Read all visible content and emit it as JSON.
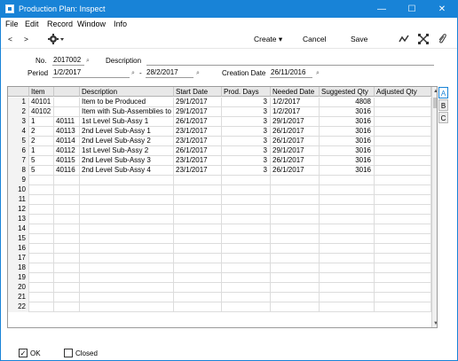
{
  "window": {
    "title": "Production Plan: Inspect",
    "minimize": "—",
    "maximize": "☐",
    "close": "✕"
  },
  "menu": [
    "File",
    "Edit",
    "Record",
    "Window",
    "Info"
  ],
  "toolbar": {
    "back": "<",
    "forward": ">",
    "create": "Create",
    "cancel": "Cancel",
    "save": "Save",
    "icons": [
      "gear-icon",
      "chart-icon",
      "expand-icon",
      "paperclip-icon"
    ]
  },
  "form": {
    "no_label": "No.",
    "no_value": "2017002",
    "description_label": "Description",
    "description_value": "",
    "period_label": "Period",
    "period_from": "1/2/2017",
    "period_sep": "-",
    "period_to": "28/2/2017",
    "creation_label": "Creation Date",
    "creation_value": "26/11/2016"
  },
  "grid": {
    "columns": [
      "",
      "Item",
      "",
      "Description",
      "Start Date",
      "Prod. Days",
      "Needed Date",
      "Suggested Qty",
      "Adjusted Qty"
    ],
    "rows": [
      [
        "1",
        "40101",
        "",
        "Item to be Produced",
        "29/1/2017",
        "3",
        "1/2/2017",
        "4808",
        ""
      ],
      [
        "2",
        "40102",
        "",
        "Item with Sub-Assemblies to b",
        "29/1/2017",
        "3",
        "1/2/2017",
        "3016",
        ""
      ],
      [
        "3",
        "1",
        "40111",
        "1st Level Sub-Assy 1",
        "26/1/2017",
        "3",
        "29/1/2017",
        "3016",
        ""
      ],
      [
        "4",
        "2",
        "40113",
        "2nd Level Sub-Assy 1",
        "23/1/2017",
        "3",
        "26/1/2017",
        "3016",
        ""
      ],
      [
        "5",
        "2",
        "40114",
        "2nd Level Sub-Assy 2",
        "23/1/2017",
        "3",
        "26/1/2017",
        "3016",
        ""
      ],
      [
        "6",
        "1",
        "40112",
        "1st Level Sub-Assy 2",
        "26/1/2017",
        "3",
        "29/1/2017",
        "3016",
        ""
      ],
      [
        "7",
        "5",
        "40115",
        "2nd Level Sub-Assy 3",
        "23/1/2017",
        "3",
        "26/1/2017",
        "3016",
        ""
      ],
      [
        "8",
        "5",
        "40116",
        "2nd Level Sub-Assy 4",
        "23/1/2017",
        "3",
        "26/1/2017",
        "3016",
        ""
      ],
      [
        "9",
        "",
        "",
        "",
        "",
        "",
        "",
        "",
        ""
      ],
      [
        "10",
        "",
        "",
        "",
        "",
        "",
        "",
        "",
        ""
      ],
      [
        "11",
        "",
        "",
        "",
        "",
        "",
        "",
        "",
        ""
      ],
      [
        "12",
        "",
        "",
        "",
        "",
        "",
        "",
        "",
        ""
      ],
      [
        "13",
        "",
        "",
        "",
        "",
        "",
        "",
        "",
        ""
      ],
      [
        "14",
        "",
        "",
        "",
        "",
        "",
        "",
        "",
        ""
      ],
      [
        "15",
        "",
        "",
        "",
        "",
        "",
        "",
        "",
        ""
      ],
      [
        "16",
        "",
        "",
        "",
        "",
        "",
        "",
        "",
        ""
      ],
      [
        "17",
        "",
        "",
        "",
        "",
        "",
        "",
        "",
        ""
      ],
      [
        "18",
        "",
        "",
        "",
        "",
        "",
        "",
        "",
        ""
      ],
      [
        "19",
        "",
        "",
        "",
        "",
        "",
        "",
        "",
        ""
      ],
      [
        "20",
        "",
        "",
        "",
        "",
        "",
        "",
        "",
        ""
      ],
      [
        "21",
        "",
        "",
        "",
        "",
        "",
        "",
        "",
        ""
      ],
      [
        "22",
        "",
        "",
        "",
        "",
        "",
        "",
        "",
        ""
      ]
    ]
  },
  "side_tabs": [
    "A",
    "B",
    "C"
  ],
  "status": {
    "ok_label": "OK",
    "ok_checked": "✓",
    "closed_label": "Closed",
    "closed_checked": ""
  },
  "colors": {
    "accent": "#1883d7"
  }
}
